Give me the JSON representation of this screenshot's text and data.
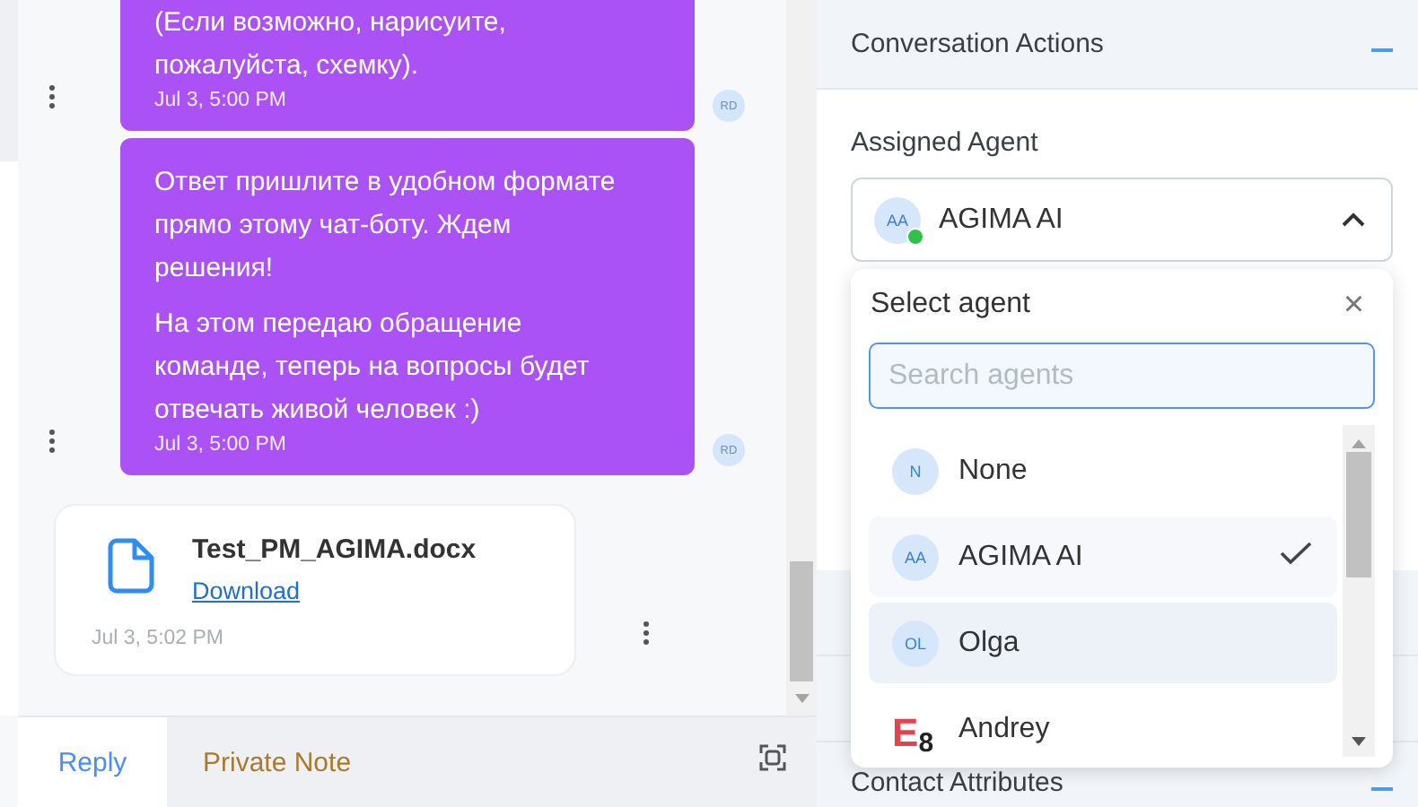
{
  "chat": {
    "messages": [
      {
        "paragraphs": [
          "(Если возможно, нарисуите,\nпожалуйста, схемку)."
        ],
        "time": "Jul 3, 5:00 PM",
        "avatar": "RD"
      },
      {
        "paragraphs": [
          "Ответ пришлите в удобном формате\nпрямо этому чат-боту. Ждем\nрешения!",
          "На этом передаю обращение\nкоманде, теперь на вопросы будет\nотвечать живой человек :)"
        ],
        "time": "Jul 3, 5:00 PM",
        "avatar": "RD"
      }
    ],
    "attachment": {
      "file_name": "Test_PM_AGIMA.docx",
      "link": "Download",
      "time": "Jul 3, 5:02 PM"
    },
    "reply_tabs": [
      {
        "label": "Reply",
        "kind": "reply",
        "selected": true
      },
      {
        "label": "Private Note",
        "kind": "note",
        "selected": false
      }
    ]
  },
  "sidebar": {
    "section": {
      "title": "Conversation Actions",
      "expanded": true
    },
    "assigned_agent": {
      "label": "Assigned Agent",
      "initials": "AA",
      "name": "AGIMA AI",
      "online": true,
      "open": true
    },
    "agent_dropdown": {
      "title": "Select agent",
      "close": "×",
      "search": {
        "placeholder": "Search agents"
      },
      "agents": [
        {
          "kind": "initials",
          "avatar": "N",
          "name": "None",
          "selected": false,
          "highlighted": false
        },
        {
          "kind": "initials",
          "avatar": "AA",
          "name": "AGIMA AI",
          "selected": true,
          "highlighted": false
        },
        {
          "kind": "initials",
          "avatar": "OL",
          "name": "Olga",
          "selected": false,
          "highlighted": true
        },
        {
          "kind": "logo",
          "logo_letter": "E",
          "logo_digit": "8",
          "name": "Andrey",
          "selected": false,
          "highlighted": false
        }
      ]
    },
    "bottom_section": {
      "title": "Contact Attributes",
      "expanded": true
    }
  }
}
